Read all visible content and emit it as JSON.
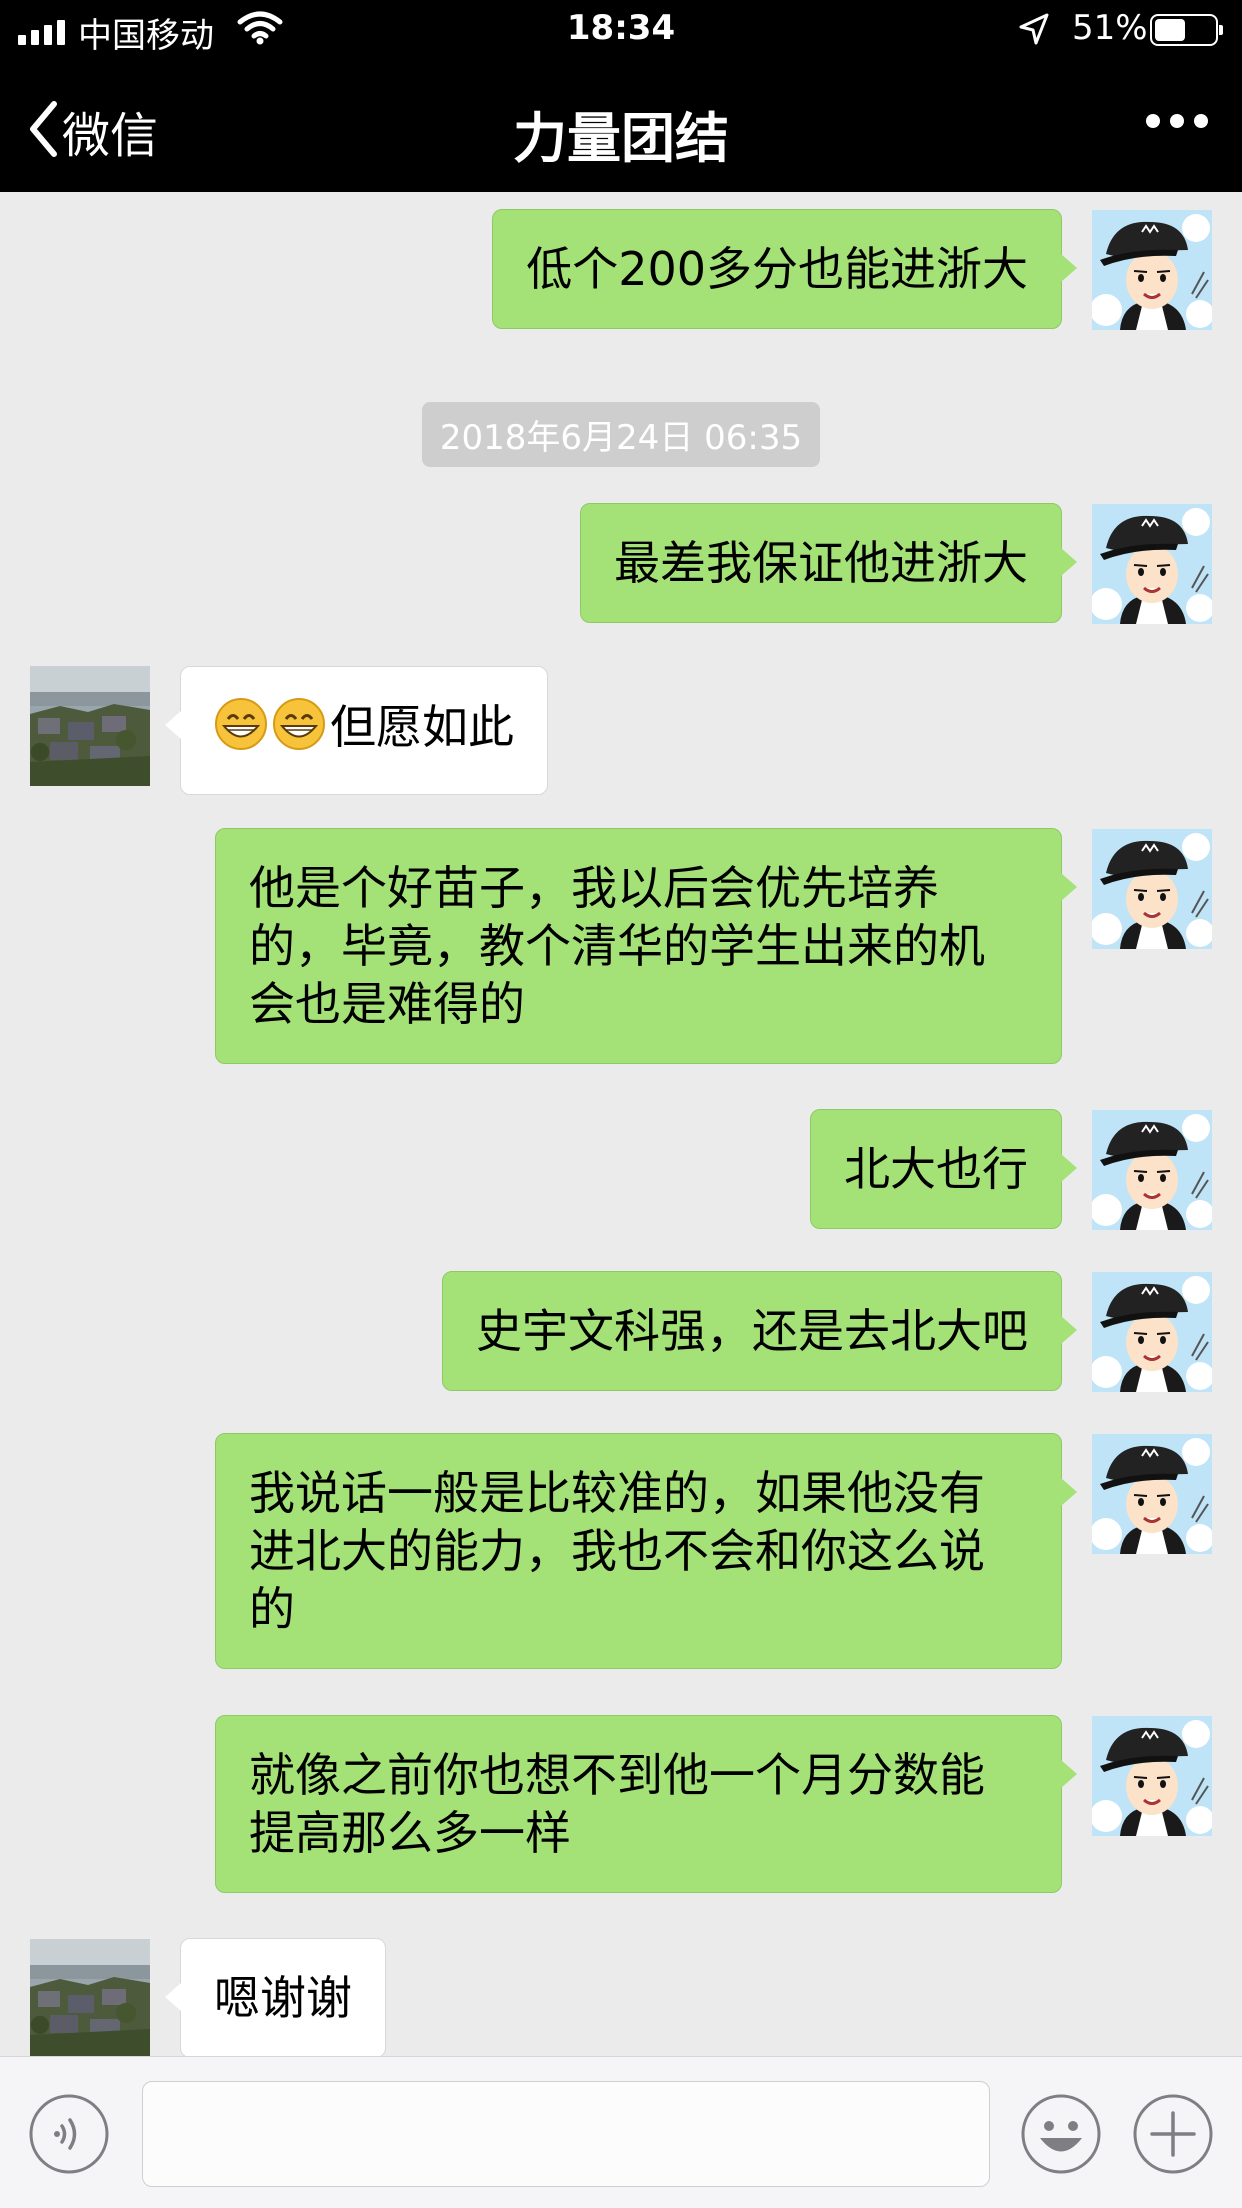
{
  "status_bar": {
    "carrier": "中国移动",
    "time": "18:34",
    "battery_percent_text": "51%",
    "battery_level": 0.51,
    "icons": [
      "signal-icon",
      "wifi-icon",
      "location-arrow-icon",
      "battery-icon"
    ]
  },
  "nav": {
    "back_label": "微信",
    "title": "力量团结",
    "more_icon": "ellipsis-icon"
  },
  "chat": {
    "timestamp": "2018年6月24日 06:35",
    "messages": [
      {
        "from": "me",
        "text": "低个200多分也能进浙大"
      },
      {
        "from": "me",
        "text": "最差我保证他进浙大"
      },
      {
        "from": "them",
        "emojis": [
          "grinning-face-emoji",
          "grinning-face-emoji"
        ],
        "text": "但愿如此"
      },
      {
        "from": "me",
        "text": "他是个好苗子，我以后会优先培养的，毕竟，教个清华的学生出来的机会也是难得的"
      },
      {
        "from": "me",
        "text": "北大也行"
      },
      {
        "from": "me",
        "text": "史宇文科强，还是去北大吧"
      },
      {
        "from": "me",
        "text": "我说话一般是比较准的，如果他没有进北大的能力，我也不会和你这么说的"
      },
      {
        "from": "me",
        "text": "就像之前你也想不到他一个月分数能提高那么多一样"
      },
      {
        "from": "them",
        "text": "嗯谢谢"
      }
    ]
  },
  "input_bar": {
    "icons": [
      "voice-icon",
      "emoji-face-icon",
      "plus-icon"
    ],
    "text_value": ""
  },
  "colors": {
    "bar_background": "#000000",
    "chat_background": "#ebebeb",
    "my_bubble": "#a4e278",
    "their_bubble": "#ffffff",
    "timestamp_pill": "#cecece"
  }
}
